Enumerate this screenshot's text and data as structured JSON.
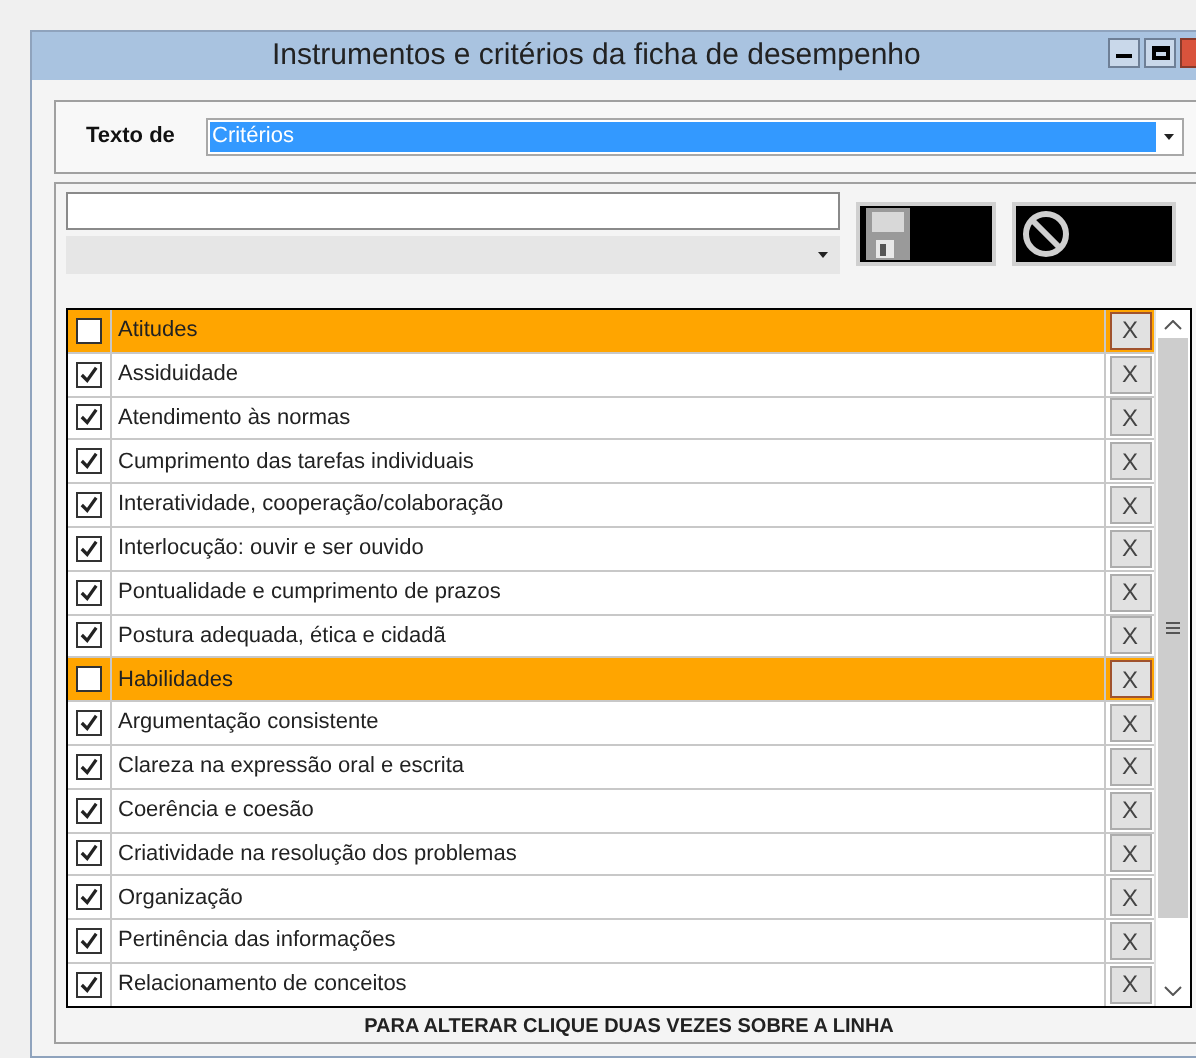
{
  "window": {
    "title": "Instrumentos e critérios da ficha de desempenho"
  },
  "filter": {
    "label": "Texto de",
    "value": "Critérios"
  },
  "criteria": [
    {
      "kind": "group",
      "label": "Atitudes",
      "checked": false,
      "remove": "X"
    },
    {
      "kind": "item",
      "label": "Assiduidade",
      "checked": true,
      "remove": "X"
    },
    {
      "kind": "item",
      "label": "Atendimento às normas",
      "checked": true,
      "remove": "X"
    },
    {
      "kind": "item",
      "label": "Cumprimento das tarefas individuais",
      "checked": true,
      "remove": "X"
    },
    {
      "kind": "item",
      "label": "Interatividade, cooperação/colaboração",
      "checked": true,
      "remove": "X"
    },
    {
      "kind": "item",
      "label": "Interlocução: ouvir e ser ouvido",
      "checked": true,
      "remove": "X"
    },
    {
      "kind": "item",
      "label": "Pontualidade e cumprimento de prazos",
      "checked": true,
      "remove": "X"
    },
    {
      "kind": "item",
      "label": "Postura adequada, ética e cidadã",
      "checked": true,
      "remove": "X"
    },
    {
      "kind": "group",
      "label": "Habilidades",
      "checked": false,
      "remove": "X"
    },
    {
      "kind": "item",
      "label": "Argumentação consistente",
      "checked": true,
      "remove": "X"
    },
    {
      "kind": "item",
      "label": "Clareza na expressão oral e escrita",
      "checked": true,
      "remove": "X"
    },
    {
      "kind": "item",
      "label": "Coerência e coesão",
      "checked": true,
      "remove": "X"
    },
    {
      "kind": "item",
      "label": "Criatividade na resolução dos problemas",
      "checked": true,
      "remove": "X"
    },
    {
      "kind": "item",
      "label": "Organização",
      "checked": true,
      "remove": "X"
    },
    {
      "kind": "item",
      "label": "Pertinência das informações",
      "checked": true,
      "remove": "X"
    },
    {
      "kind": "item",
      "label": "Relacionamento de conceitos",
      "checked": true,
      "remove": "X"
    }
  ],
  "hint": "PARA ALTERAR CLIQUE DUAS VEZES SOBRE A LINHA"
}
